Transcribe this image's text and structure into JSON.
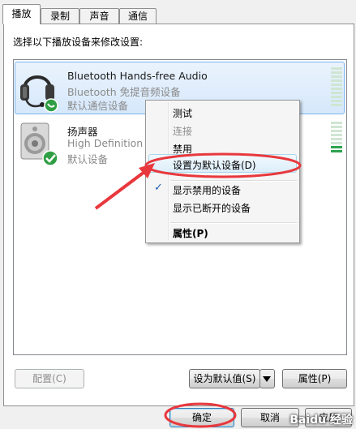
{
  "tabs": [
    "播放",
    "录制",
    "声音",
    "通信"
  ],
  "instruction": "选择以下播放设备来修改设置:",
  "devices": [
    {
      "name": "Bluetooth Hands-free Audio",
      "line2": "Bluetooth 免提音频设备",
      "line3": "默认通信设备"
    },
    {
      "name": "扬声器",
      "line2": "High Definition A",
      "line3": "默认设备"
    }
  ],
  "context_menu": {
    "items": [
      {
        "label": "测试",
        "state": "enabled"
      },
      {
        "label": "连接",
        "state": "disabled"
      },
      {
        "label": "禁用",
        "state": "enabled"
      },
      {
        "label": "设置为默认设备(D)",
        "state": "highlighted"
      },
      {
        "label": "显示禁用的设备",
        "state": "checked"
      },
      {
        "label": "显示已断开的设备",
        "state": "enabled"
      },
      {
        "label": "属性(P)",
        "state": "bold"
      }
    ]
  },
  "buttons": {
    "configure": "配置(C)",
    "set_default": "设为默认值(S)",
    "properties": "属性(P)",
    "ok": "确定",
    "cancel": "取消",
    "apply": "应用"
  },
  "watermark": "Baidu 经验",
  "colors": {
    "selection": "#d6e8fb",
    "annotation_red": "#e8383d",
    "meter_green": "#2ea44f"
  }
}
